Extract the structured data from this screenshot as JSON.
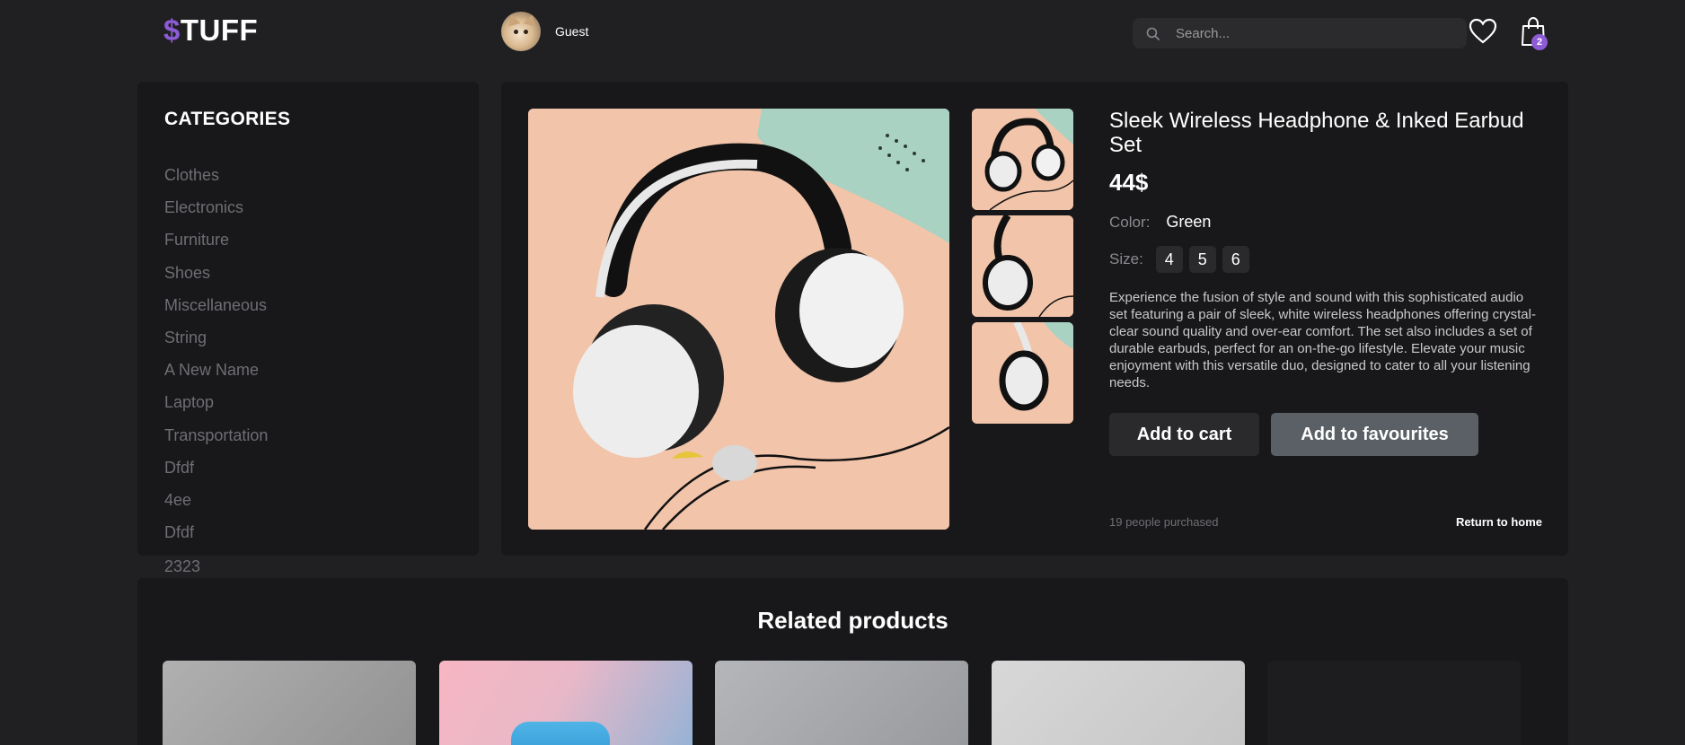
{
  "header": {
    "logo_symbol": "$",
    "logo_text": "TUFF",
    "user_name": "Guest",
    "search_placeholder": "Search...",
    "cart_count": "2"
  },
  "sidebar": {
    "title": "CATEGORIES",
    "items": [
      "Clothes",
      "Electronics",
      "Furniture",
      "Shoes",
      "Miscellaneous",
      "String",
      "A New Name",
      "Laptop",
      "Transportation",
      "Dfdf",
      "4ee",
      "Dfdf"
    ],
    "overflow_item": "2323"
  },
  "product": {
    "title": "Sleek Wireless Headphone & Inked Earbud Set",
    "price": "44$",
    "color_label": "Color:",
    "color_value": "Green",
    "size_label": "Size:",
    "sizes": [
      "4",
      "5",
      "6"
    ],
    "description": "Experience the fusion of style and sound with this sophisticated audio set featuring a pair of sleek, white wireless headphones offering crystal-clear sound quality and over-ear comfort. The set also includes a set of durable earbuds, perfect for an on-the-go lifestyle. Elevate your music enjoyment with this versatile duo, designed to cater to all your listening needs.",
    "add_to_cart": "Add to cart",
    "add_to_favourites": "Add to favourites",
    "purchased": "19 people purchased",
    "return_home": "Return to home"
  },
  "related": {
    "title": "Related products"
  },
  "colors": {
    "accent": "#8e5bd6",
    "background": "#202023",
    "panel": "#18181a",
    "muted_text": "#6e6e74"
  },
  "icons": {
    "search": "search-icon",
    "favourites": "heart-icon",
    "cart": "shopping-bag-icon"
  }
}
